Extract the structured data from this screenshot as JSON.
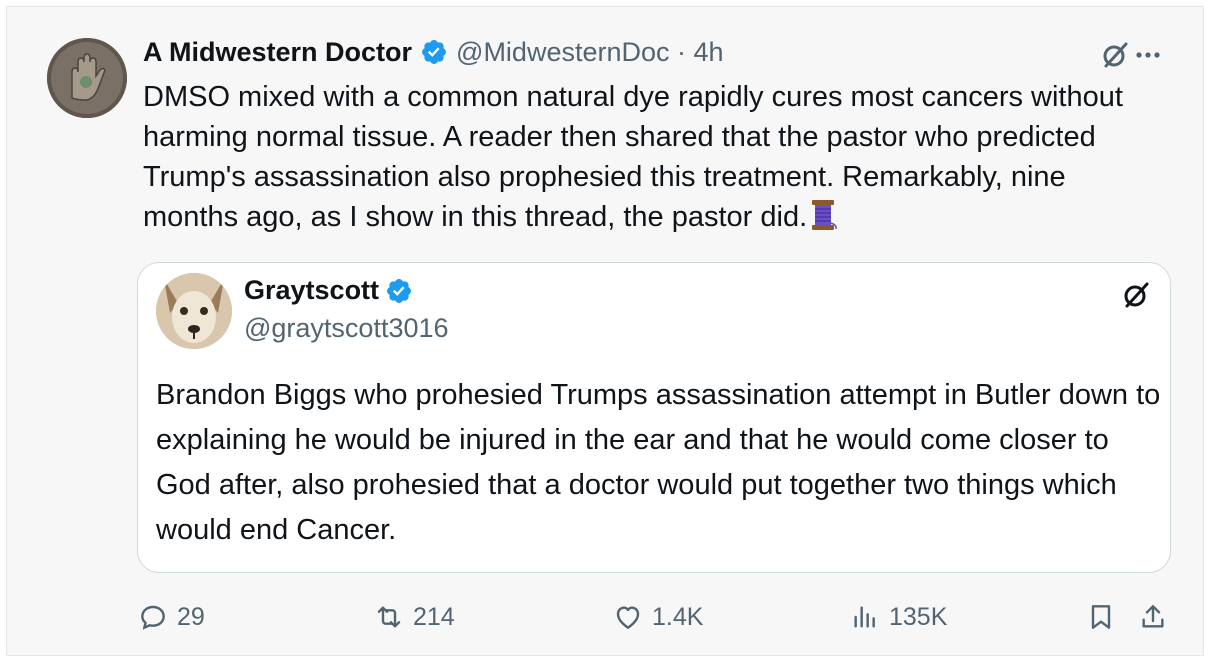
{
  "tweet": {
    "author_name": "A Midwestern Doctor",
    "handle_time": "@MidwesternDoc · 4h",
    "text": "DMSO mixed with a common natural dye rapidly cures most cancers without harming normal tissue. A reader then shared that the pastor who predicted Trump's assassination also prophesied this treatment. Remarkably, nine months ago, as I show in this thread, the pastor did.",
    "emoji": "spool-of-thread"
  },
  "quoted": {
    "author_name": "Graytscott",
    "handle": "@graytscott3016",
    "text": "Brandon Biggs who prohesied Trumps assassination attempt in Butler down to explaining he would be injured in the ear and that he would come closer to God after, also prohesied that a doctor would put together two things which would end Cancer."
  },
  "actions": {
    "replies": "29",
    "reposts": "214",
    "likes": "1.4K",
    "views": "135K"
  },
  "icons": [
    "grok-icon",
    "more-icon",
    "verified-badge-icon",
    "reply-icon",
    "repost-icon",
    "like-icon",
    "views-icon",
    "bookmark-icon",
    "share-icon"
  ],
  "colors": {
    "verified": "#1d9bf0",
    "muted": "#536471",
    "text": "#0f1419"
  }
}
